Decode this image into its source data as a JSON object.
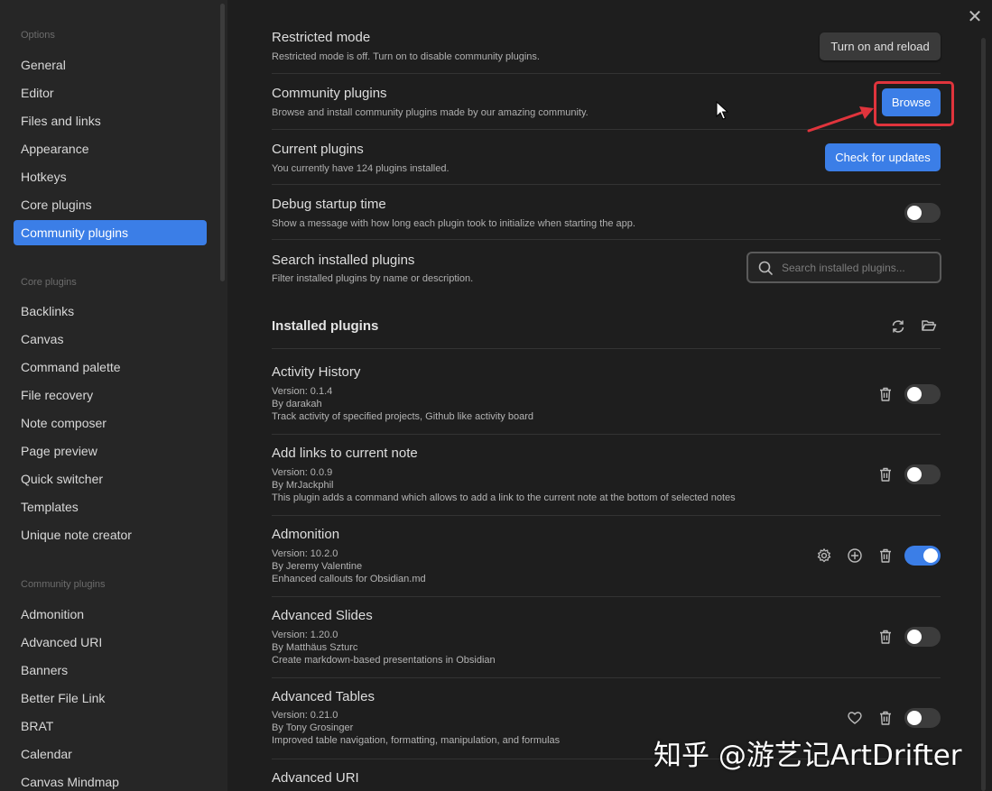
{
  "sidebar": {
    "options_label": "Options",
    "options": [
      "General",
      "Editor",
      "Files and links",
      "Appearance",
      "Hotkeys",
      "Core plugins",
      "Community plugins"
    ],
    "active_item": "Community plugins",
    "core_label": "Core plugins",
    "core": [
      "Backlinks",
      "Canvas",
      "Command palette",
      "File recovery",
      "Note composer",
      "Page preview",
      "Quick switcher",
      "Templates",
      "Unique note creator"
    ],
    "community_label": "Community plugins",
    "community": [
      "Admonition",
      "Advanced URI",
      "Banners",
      "Better File Link",
      "BRAT",
      "Calendar",
      "Canvas Mindmap"
    ]
  },
  "settings": {
    "restricted": {
      "title": "Restricted mode",
      "desc": "Restricted mode is off. Turn on to disable community plugins.",
      "button": "Turn on and reload"
    },
    "community": {
      "title": "Community plugins",
      "desc": "Browse and install community plugins made by our amazing community.",
      "button": "Browse"
    },
    "current": {
      "title": "Current plugins",
      "desc": "You currently have 124 plugins installed.",
      "button": "Check for updates"
    },
    "debug": {
      "title": "Debug startup time",
      "desc": "Show a message with how long each plugin took to initialize when starting the app.",
      "enabled": false
    },
    "search": {
      "title": "Search installed plugins",
      "desc": "Filter installed plugins by name or description.",
      "placeholder": "Search installed plugins..."
    }
  },
  "installed": {
    "title": "Installed plugins",
    "plugins": [
      {
        "name": "Activity History",
        "version": "Version: 0.1.4",
        "author": "By darakah",
        "desc": "Track activity of specified projects, Github like activity board",
        "enabled": false,
        "icons": [
          "trash-icon"
        ]
      },
      {
        "name": "Add links to current note",
        "version": "Version: 0.0.9",
        "author": "By MrJackphil",
        "desc": "This plugin adds a command which allows to add a link to the current note at the bottom of selected notes",
        "enabled": false,
        "icons": [
          "trash-icon"
        ]
      },
      {
        "name": "Admonition",
        "version": "Version: 10.2.0",
        "author": "By Jeremy Valentine",
        "desc": "Enhanced callouts for Obsidian.md",
        "enabled": true,
        "icons": [
          "gear-icon",
          "plus-circle-icon",
          "trash-icon"
        ]
      },
      {
        "name": "Advanced Slides",
        "version": "Version: 1.20.0",
        "author": "By Matthäus Szturc",
        "desc": "Create markdown-based presentations in Obsidian",
        "enabled": false,
        "icons": [
          "trash-icon"
        ]
      },
      {
        "name": "Advanced Tables",
        "version": "Version: 0.21.0",
        "author": "By Tony Grosinger",
        "desc": "Improved table navigation, formatting, manipulation, and formulas",
        "enabled": false,
        "icons": [
          "heart-icon",
          "trash-icon"
        ]
      }
    ],
    "partial_plugin": "Advanced URI"
  },
  "watermark": "知乎 @游艺记ArtDrifter",
  "colors": {
    "accent": "#3b7ee7",
    "highlight": "#e0343c"
  }
}
